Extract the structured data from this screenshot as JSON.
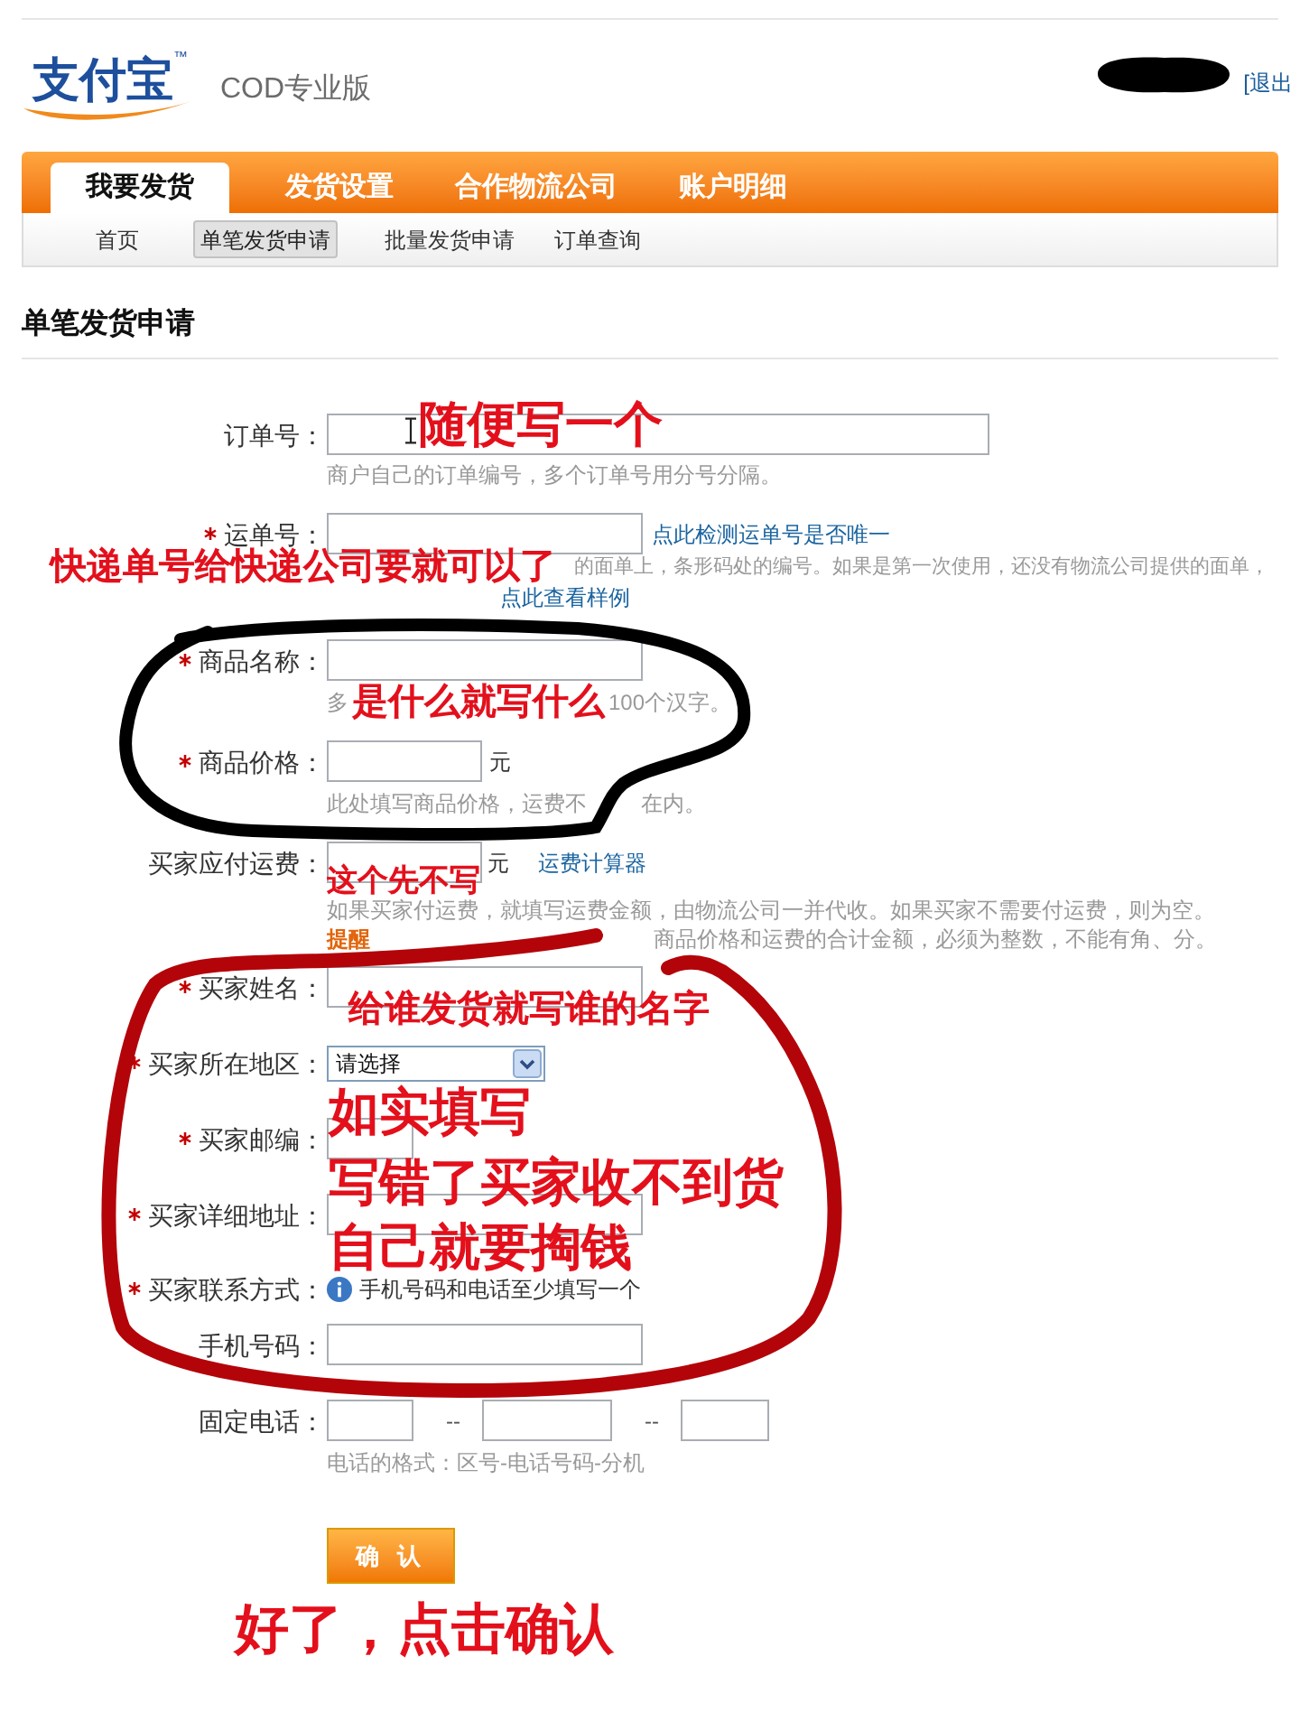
{
  "header": {
    "logo": {
      "text": "支付宝",
      "trademark": "™"
    },
    "product": "COD专业版",
    "logout": "[退出"
  },
  "nav": {
    "tabs": [
      {
        "label": "我要发货",
        "selected": true
      },
      {
        "label": "发货设置",
        "selected": false
      },
      {
        "label": "合作物流公司",
        "selected": false
      },
      {
        "label": "账户明细",
        "selected": false
      }
    ],
    "subtabs": [
      {
        "label": "首页",
        "selected": false
      },
      {
        "label": "单笔发货申请",
        "selected": true
      },
      {
        "label": "批量发货申请",
        "selected": false
      },
      {
        "label": "订单查询",
        "selected": false
      }
    ]
  },
  "page_title": "单笔发货申请",
  "form": {
    "rows": [
      {
        "label": "订单号：",
        "required": false,
        "parts": [
          {
            "kind": "input"
          }
        ],
        "hints": [
          [
            {
              "kind": "text",
              "text": "商户自己的订单编号，多个订单号用分号分隔。"
            }
          ]
        ],
        "annotations": [
          "随便写一个"
        ]
      },
      {
        "label": "运单号：",
        "required": true,
        "parts": [
          {
            "kind": "input"
          },
          {
            "kind": "link",
            "text": "点此检测运单号是否唯一"
          }
        ],
        "hints": [
          [
            {
              "kind": "annotation",
              "text": "快递单号给快递公司要就可以了"
            },
            {
              "kind": "text",
              "text": "的面单上，条形码处的编号。如果是第一次使用，还没有物流公司提供的面单，"
            }
          ],
          [
            {
              "kind": "link",
              "text": "点此查看样例"
            }
          ]
        ]
      },
      {
        "label": "商品名称：",
        "required": true,
        "parts": [
          {
            "kind": "input"
          }
        ],
        "hints": [
          [
            {
              "kind": "text",
              "text": "多"
            },
            {
              "kind": "annotation",
              "text": "是什么就写什么"
            },
            {
              "kind": "text",
              "text": "100个汉字。"
            }
          ]
        ]
      },
      {
        "label": "商品价格：",
        "required": true,
        "parts": [
          {
            "kind": "input"
          },
          {
            "kind": "unit",
            "text": "元"
          }
        ],
        "hints": [
          [
            {
              "kind": "text",
              "text": "此处填写商品价格，运费不"
            },
            {
              "kind": "text",
              "text": "在内。"
            }
          ]
        ]
      },
      {
        "label": "买家应付运费：",
        "required": false,
        "parts": [
          {
            "kind": "input"
          },
          {
            "kind": "unit",
            "text": "元"
          },
          {
            "kind": "link",
            "text": "运费计算器"
          }
        ],
        "hints": [
          [
            {
              "kind": "text",
              "text": "如果买家付运费，就填写运费金额，由物流公司一并代收。如果买家不需要付运费，则为空。"
            }
          ],
          [
            {
              "kind": "note",
              "text": "提醒"
            },
            {
              "kind": "text",
              "text": "商品价格和运费的合计金额，必须为整数，不能有角、分。"
            }
          ]
        ],
        "annotations": [
          "这个先不写"
        ]
      },
      {
        "label": "买家姓名：",
        "required": true,
        "parts": [
          {
            "kind": "input"
          }
        ],
        "annotations": [
          "给谁发货就写谁的名字"
        ]
      },
      {
        "label": "买家所在地区：",
        "required": true,
        "parts": [
          {
            "kind": "select",
            "value": "请选择"
          }
        ]
      },
      {
        "label": "买家邮编：",
        "required": true,
        "parts": [
          {
            "kind": "input"
          }
        ],
        "annotations": [
          "如实填写",
          "写错了买家收不到货",
          "自己就要掏钱"
        ]
      },
      {
        "label": "买家详细地址：",
        "required": true,
        "parts": [
          {
            "kind": "input"
          }
        ]
      },
      {
        "label": "买家联系方式：",
        "required": true,
        "parts": [
          {
            "kind": "info",
            "text": "手机号码和电话至少填写一个"
          }
        ]
      },
      {
        "label": "手机号码：",
        "required": false,
        "parts": [
          {
            "kind": "input"
          }
        ]
      },
      {
        "label": "固定电话：",
        "required": false,
        "parts": [
          {
            "kind": "input"
          },
          {
            "kind": "separator",
            "text": "--"
          },
          {
            "kind": "input"
          },
          {
            "kind": "separator",
            "text": "--"
          },
          {
            "kind": "input"
          }
        ],
        "hints": [
          [
            {
              "kind": "text",
              "text": "电话的格式：区号-电话号码-分机"
            }
          ]
        ]
      }
    ]
  },
  "submit": {
    "label": "确 认",
    "annotation": "好了，点击确认"
  }
}
